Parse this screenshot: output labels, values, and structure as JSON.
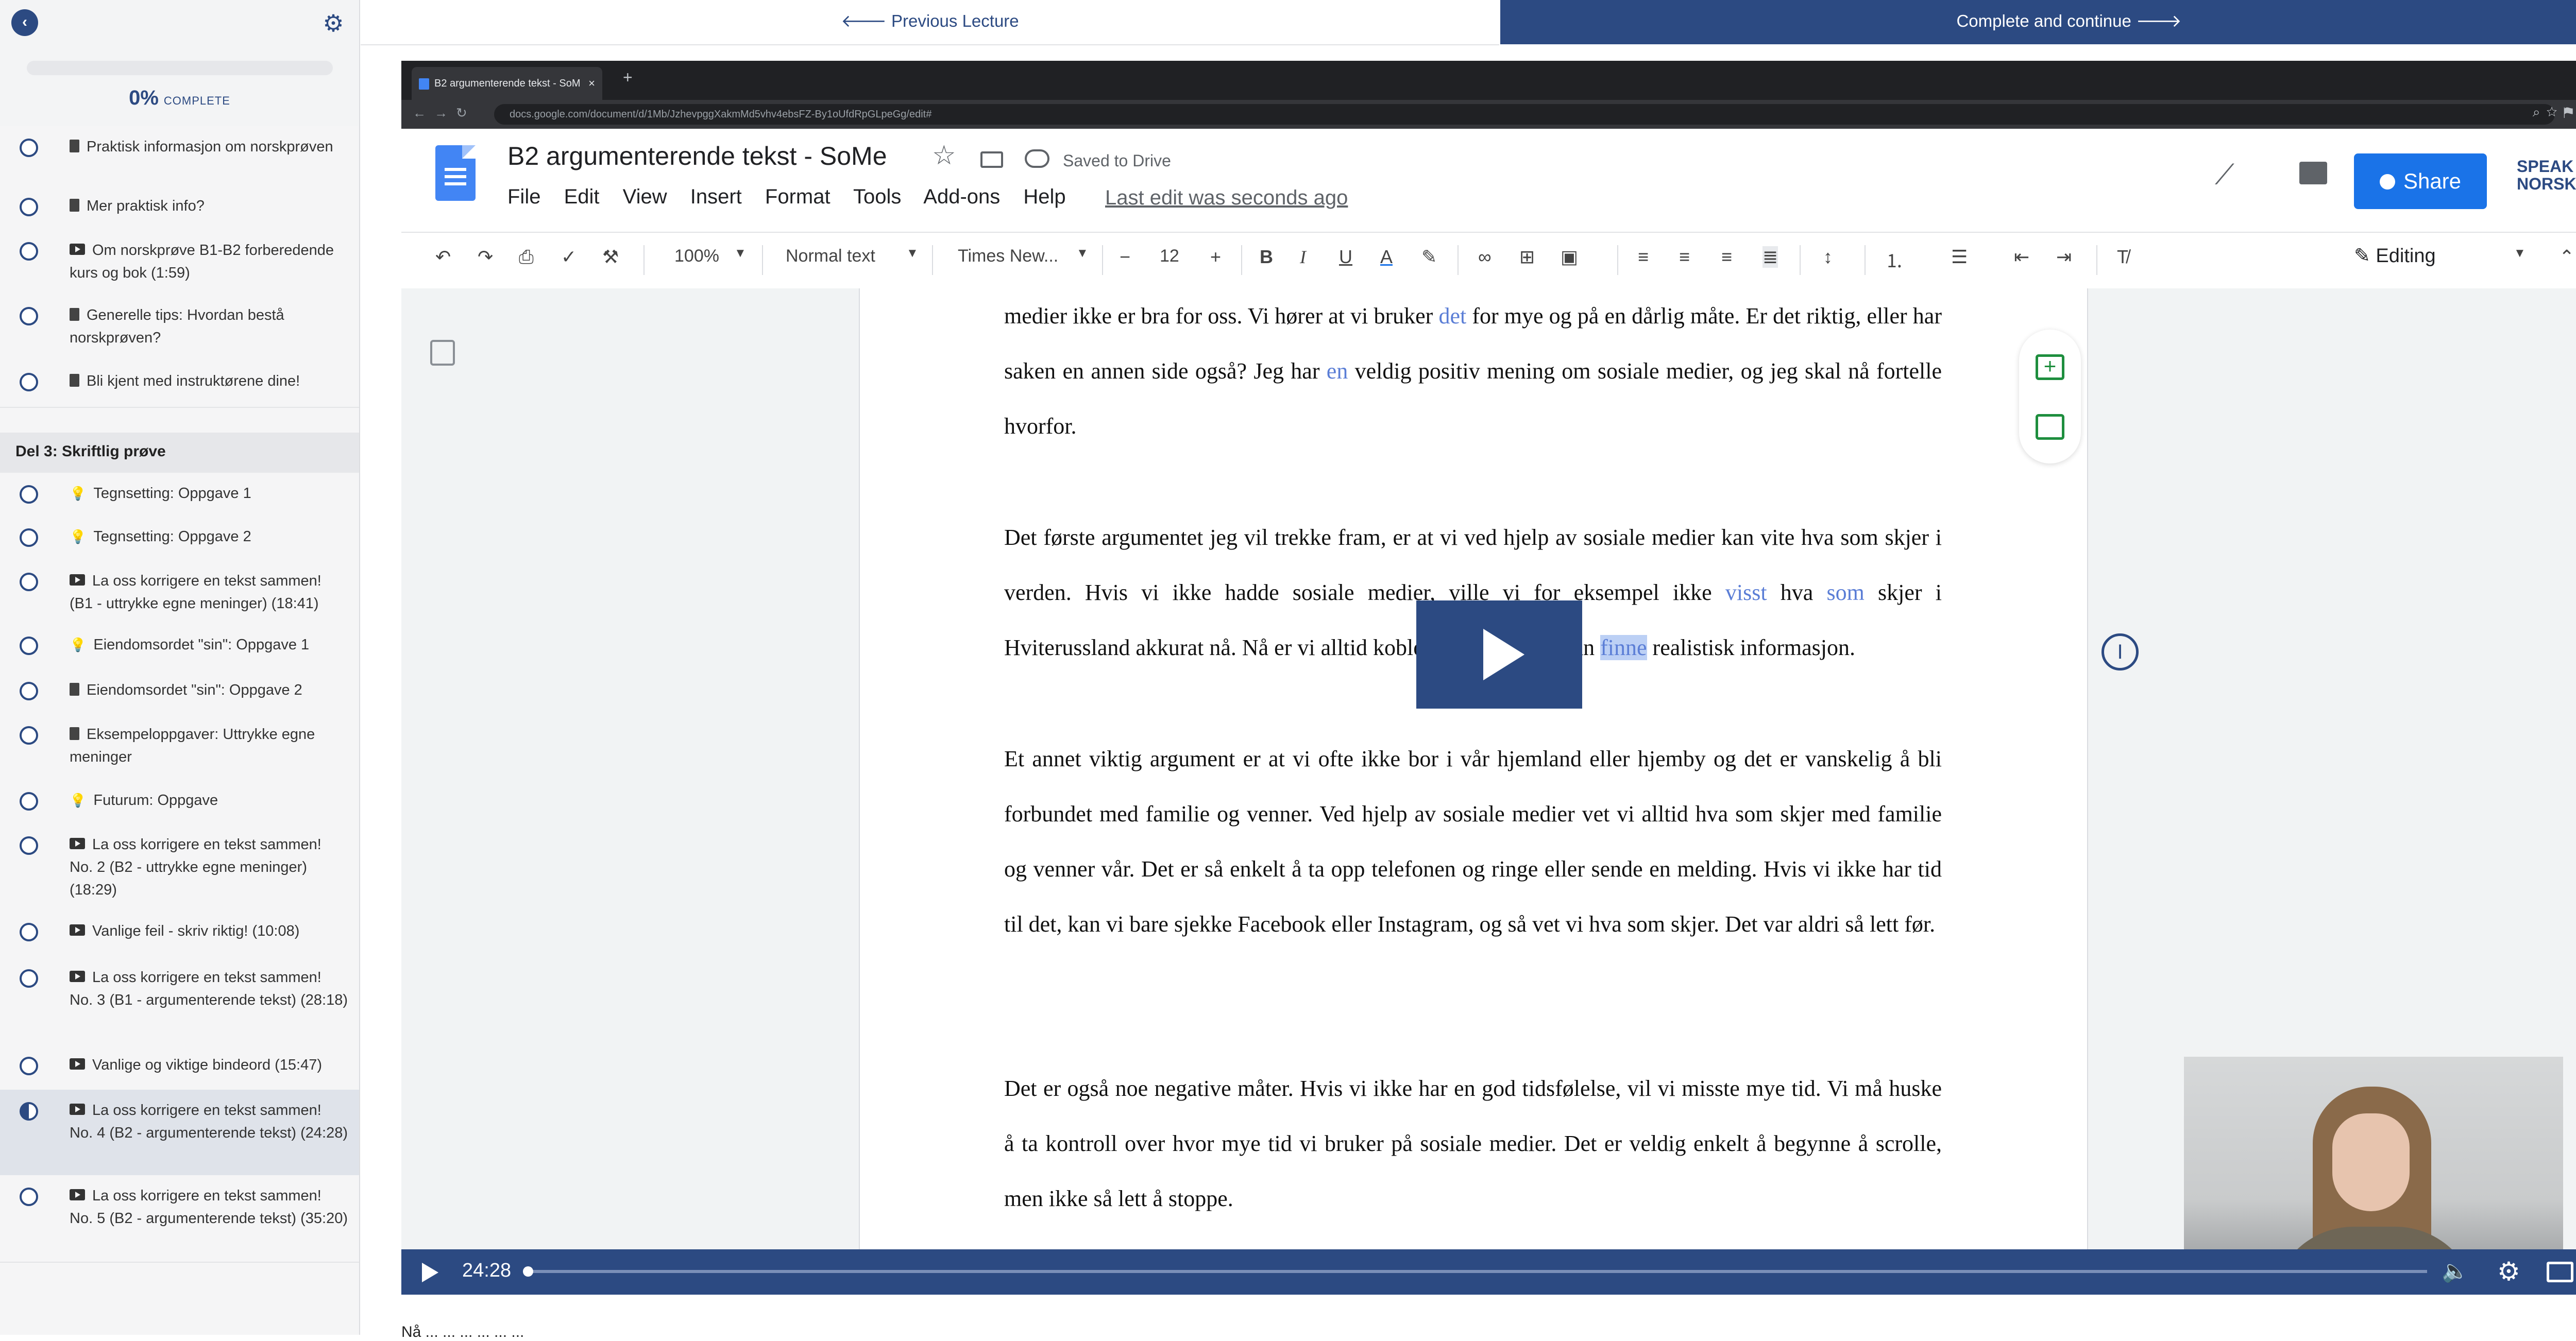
{
  "sidebar": {
    "progress_percent": "0%",
    "progress_label": "COMPLETE",
    "progress_value": 0,
    "section_title": "Del 3: Skriftlig prøve",
    "lessons_part2": [
      {
        "type": "doc",
        "title": "Praktisk informasjon om norskprøven",
        "status": "open"
      },
      {
        "type": "doc",
        "title": "Mer praktisk info?",
        "status": "open"
      },
      {
        "type": "video",
        "title": "Om norskprøve B1-B2 forberedende kurs og bok (1:59)",
        "status": "open"
      },
      {
        "type": "doc",
        "title": "Generelle tips: Hvordan bestå norskprøven?",
        "status": "open"
      },
      {
        "type": "doc",
        "title": "Bli kjent med instruktørene dine!",
        "status": "open"
      }
    ],
    "lessons_part3": [
      {
        "type": "bulb",
        "title": "Tegnsetting: Oppgave 1",
        "status": "open"
      },
      {
        "type": "bulb",
        "title": "Tegnsetting: Oppgave 2",
        "status": "open"
      },
      {
        "type": "video",
        "title": "La oss korrigere en tekst sammen! (B1 - uttrykke egne meninger) (18:41)",
        "status": "open"
      },
      {
        "type": "bulb",
        "title": "Eiendomsordet \"sin\": Oppgave 1",
        "status": "open"
      },
      {
        "type": "doc",
        "title": "Eiendomsordet \"sin\": Oppgave 2",
        "status": "open"
      },
      {
        "type": "doc",
        "title": "Eksempeloppgaver: Uttrykke egne meninger",
        "status": "open"
      },
      {
        "type": "bulb",
        "title": "Futurum: Oppgave",
        "status": "open"
      },
      {
        "type": "video",
        "title": "La oss korrigere en tekst sammen! No. 2 (B2 - uttrykke egne meninger) (18:29)",
        "status": "open"
      },
      {
        "type": "video",
        "title": "Vanlige feil - skriv riktig! (10:08)",
        "status": "open"
      },
      {
        "type": "video",
        "title": "La oss korrigere en tekst sammen! No. 3 (B1 - argumenterende tekst) (28:18)",
        "status": "open"
      },
      {
        "type": "video",
        "title": "Vanlige og viktige bindeord (15:47)",
        "status": "open"
      },
      {
        "type": "video",
        "title": "La oss korrigere en tekst sammen! No. 4 (B2 - argumenterende tekst) (24:28)",
        "status": "in-progress"
      },
      {
        "type": "video",
        "title": "La oss korrigere en tekst sammen! No. 5 (B2 - argumenterende tekst) (35:20)",
        "status": "open"
      }
    ]
  },
  "nav": {
    "previous_label": "🡐 Previous Lecture",
    "complete_label": "Complete and continue 🡒"
  },
  "browser": {
    "tab_title": "B2 argumenterende tekst - SoM",
    "url": "docs.google.com/document/d/1Mb/JzhevpggXakmMd5vhv4ebsFZ-By1oUfdRpGLpeGg/edit#"
  },
  "docs": {
    "title": "B2 argumenterende tekst - SoMe",
    "saved_status": "Saved to Drive",
    "menu": [
      "File",
      "Edit",
      "View",
      "Insert",
      "Format",
      "Tools",
      "Add-ons",
      "Help"
    ],
    "last_edit": "Last edit was seconds ago",
    "share_label": "Share",
    "logo_text_1": "SPEAK",
    "logo_text_2": "NORSK",
    "zoom": "100%",
    "style": "Normal text",
    "font": "Times New...",
    "font_size": "12",
    "mode": "Editing"
  },
  "document": {
    "p1": {
      "a": "medier ikke er bra for oss. Vi hører at vi bruker ",
      "b": "det",
      "c": " for mye og på en dårlig måte. Er det riktig, eller har saken en annen side også? Jeg har ",
      "d": "en",
      "e": " veldig positiv mening om sosiale medier, og jeg skal nå fortelle hvorfor."
    },
    "p2": {
      "a": "Det første argumentet jeg vil trekke fram, er at vi ved hjelp av sosiale medier kan vite hva som skjer i verden. Hvis vi ikke hadde sosiale medier, ville vi for eksempel ikke ",
      "b": "visst",
      "c": " hva ",
      "d": "som",
      "e": " skjer i Hviterussland akkurat nå. Nå er vi alltid koblet til nyheter og kan ",
      "f": "finne",
      "g": " realistisk informasjon."
    },
    "p3": "Et annet viktig argument er at vi ofte ikke bor i vår hjemland eller hjemby og det er vanskelig å bli forbundet med familie og venner. Ved hjelp av sosiale medier vet vi alltid hva som skjer med familie og venner vår. Det er så enkelt å ta opp telefonen og ringe eller sende en melding. Hvis vi ikke har tid til det, kan vi bare sjekke Facebook eller Instagram, og så vet vi hva som skjer. Det var aldri så lett før.",
    "p4": "Det er også noe negative måter. Hvis vi ikke har en god tidsfølelse, vil vi misste mye tid. Vi må huske å ta kontroll over hvor mye tid vi bruker på sosiale medier. Det er veldig enkelt å begynne å scrolle, men ikke så lett å stoppe."
  },
  "player": {
    "time": "24:28",
    "progress": 0.0
  },
  "below_video_text": "Nå ... ... ... ... ... ..."
}
